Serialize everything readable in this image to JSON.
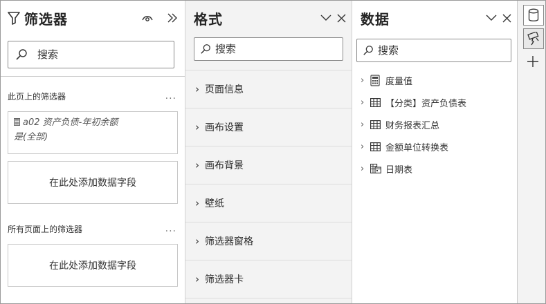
{
  "filters": {
    "title": "筛选器",
    "search_placeholder": "搜索",
    "page_section": "此页上的筛选器",
    "more": "...",
    "card": {
      "field": "a02 资产负债-年初余额",
      "state": "是(全部)"
    },
    "add_field": "在此处添加数据字段",
    "all_pages_section": "所有页面上的筛选器"
  },
  "format": {
    "title": "格式",
    "search_placeholder": "搜索",
    "items": [
      "页面信息",
      "画布设置",
      "画布背景",
      "壁纸",
      "筛选器窗格",
      "筛选器卡"
    ]
  },
  "data": {
    "title": "数据",
    "search_placeholder": "搜索",
    "tree": [
      "度量值",
      "【分类】资产负债表",
      "财务报表汇总",
      "金额单位转换表",
      "日期表"
    ]
  }
}
